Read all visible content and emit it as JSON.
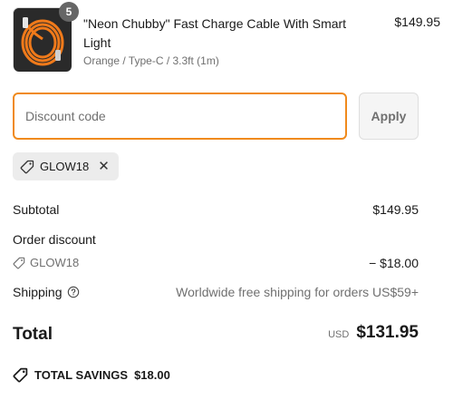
{
  "product": {
    "title": "\"Neon Chubby\" Fast Charge Cable With Smart Light",
    "variant": "Orange / Type-C / 3.3ft (1m)",
    "price": "$149.95",
    "quantity": "5",
    "thumb_icon": "orange-cable-image"
  },
  "discount": {
    "placeholder": "Discount code",
    "value": "",
    "apply_label": "Apply"
  },
  "applied_code": {
    "code": "GLOW18",
    "remove_icon": "close-icon"
  },
  "summary": {
    "subtotal_label": "Subtotal",
    "subtotal_value": "$149.95",
    "order_discount_label": "Order discount",
    "discount_code": "GLOW18",
    "discount_value": "− $18.00",
    "shipping_label": "Shipping",
    "shipping_value": "Worldwide free shipping for orders US$59+",
    "total_label": "Total",
    "currency": "USD",
    "total_value": "$131.95",
    "savings_label": "TOTAL SAVINGS",
    "savings_value": "$18.00"
  },
  "colors": {
    "input_focus": "#f08a1c",
    "cable": "#f07a1a",
    "muted_text": "#707070"
  }
}
